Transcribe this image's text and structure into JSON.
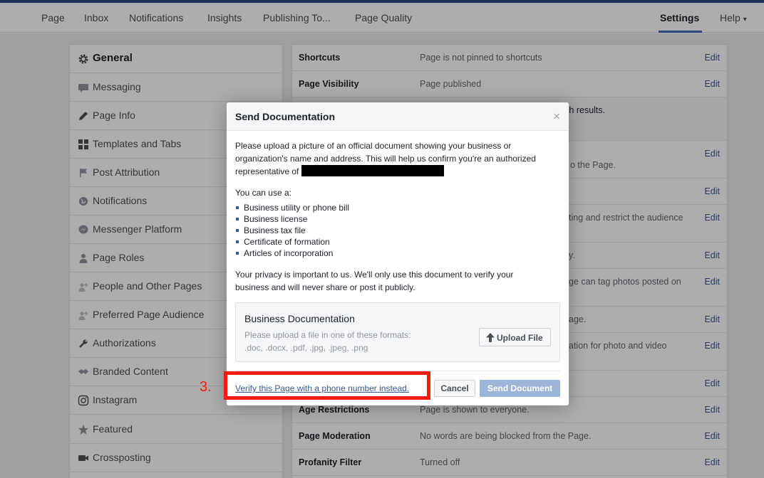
{
  "nav": {
    "items": [
      "Page",
      "Inbox",
      "Notifications",
      "Insights",
      "Publishing To...",
      "Page Quality"
    ],
    "settings": "Settings",
    "help": "Help",
    "help_caret": "▾"
  },
  "sidebar": {
    "items": [
      {
        "label": "General",
        "icon": "gear-icon",
        "active": true
      },
      {
        "label": "Messaging",
        "icon": "chat-icon"
      },
      {
        "label": "Page Info",
        "icon": "pencil-icon"
      },
      {
        "label": "Templates and Tabs",
        "icon": "grid-icon"
      },
      {
        "label": "Post Attribution",
        "icon": "flag-icon"
      },
      {
        "label": "Notifications",
        "icon": "globe-icon"
      },
      {
        "label": "Messenger Platform",
        "icon": "messenger-icon"
      },
      {
        "label": "Page Roles",
        "icon": "person-icon"
      },
      {
        "label": "People and Other Pages",
        "icon": "people-icon"
      },
      {
        "label": "Preferred Page Audience",
        "icon": "audience-icon"
      },
      {
        "label": "Authorizations",
        "icon": "wrench-icon"
      },
      {
        "label": "Branded Content",
        "icon": "handshake-icon"
      },
      {
        "label": "Instagram",
        "icon": "instagram-icon"
      },
      {
        "label": "Featured",
        "icon": "star-icon"
      },
      {
        "label": "Crossposting",
        "icon": "video-icon"
      }
    ]
  },
  "settings": {
    "edit_label": "Edit",
    "rows": [
      {
        "title": "Shortcuts",
        "value": "Page is not pinned to shortcuts"
      },
      {
        "title": "Page Visibility",
        "value": "Page published"
      },
      {
        "title": "Age Restrictions",
        "value": "Page is shown to everyone."
      },
      {
        "title": "Page Moderation",
        "value": "No words are being blocked from the Page."
      },
      {
        "title": "Profanity Filter",
        "value": "Turned off"
      }
    ],
    "fragments": [
      "rch results.",
      "o the Page.",
      "ting and restrict the audience",
      "y.",
      "ge can tag photos posted on",
      "age.",
      "ation for photo and video"
    ]
  },
  "dialog": {
    "title": "Send Documentation",
    "close": "×",
    "intro_line1": "Please upload a picture of an official document showing your business or",
    "intro_line2": "organization's name and address. This will help us confirm you're an authorized",
    "intro_line3": "representative of",
    "use_label": "You can use a:",
    "doc_types": [
      "Business utility or phone bill",
      "Business license",
      "Business tax file",
      "Certificate of formation",
      "Articles of incorporation"
    ],
    "privacy_line1": "Your privacy is important to us. We'll only use this document to verify your",
    "privacy_line2": "business and will never share or post it publicly.",
    "doc_box_title": "Business Documentation",
    "doc_box_hint1": "Please upload a file in one of these formats:",
    "doc_box_hint2": ".doc, .docx, .pdf, .jpg, .jpeg, .png",
    "upload_label": "Upload File",
    "verify_link": "Verify this Page with a phone number instead.",
    "cancel_label": "Cancel",
    "send_label": "Send Document"
  },
  "annotation": {
    "number": "3.",
    "color": "#f21c0d"
  },
  "colors": {
    "accent": "#4267b2",
    "link": "#385898",
    "send_disabled": "#9cb4d8"
  }
}
